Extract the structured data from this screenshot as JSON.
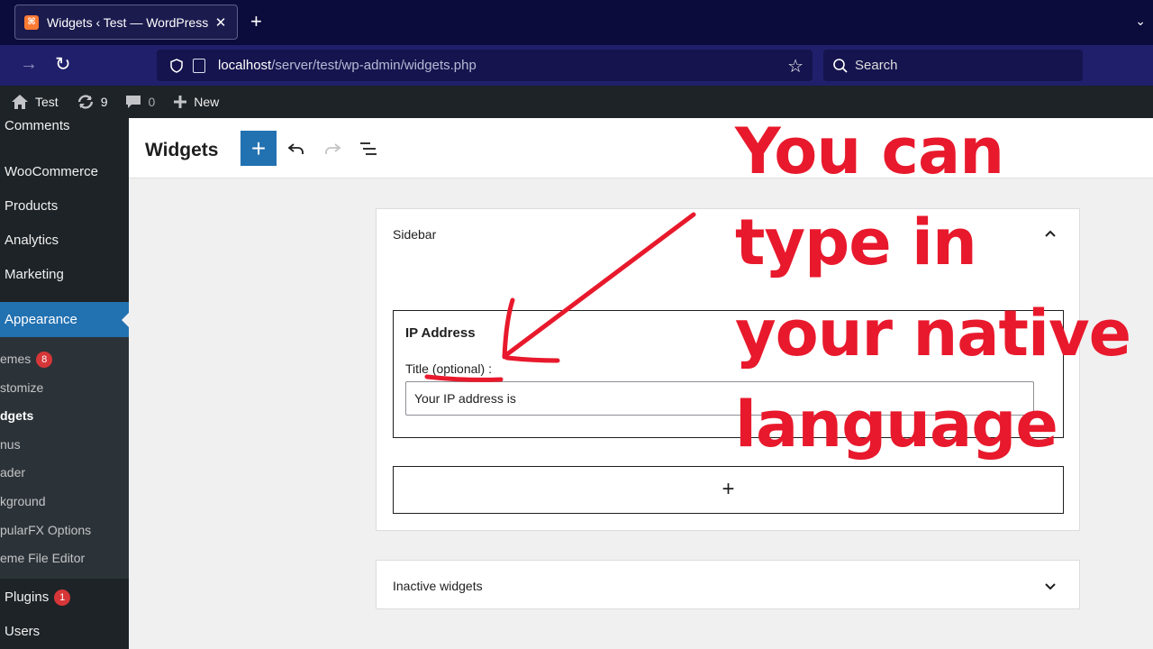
{
  "browser": {
    "tab_title": "Widgets ‹ Test — WordPress",
    "tab_close": "✕",
    "new_tab": "+",
    "url_host": "localhost",
    "url_path": "/server/test/wp-admin/widgets.php",
    "search_placeholder": "Search"
  },
  "adminbar": {
    "site_name": "Test",
    "updates_count": "9",
    "comments_count": "0",
    "new_label": "New"
  },
  "sidebar": {
    "items": {
      "comments": "Comments",
      "woocommerce": "WooCommerce",
      "products": "Products",
      "analytics": "Analytics",
      "marketing": "Marketing",
      "appearance": "Appearance",
      "plugins": "Plugins",
      "plugins_badge": "1",
      "users": "Users"
    },
    "submenu": {
      "themes": "emes",
      "themes_badge": "8",
      "customize": "stomize",
      "widgets": "dgets",
      "menus": "nus",
      "header": "ader",
      "background": "kground",
      "popularfx": "pularFX Options",
      "theme_editor": "eme File Editor"
    }
  },
  "editor": {
    "title": "Widgets",
    "add_block": "+"
  },
  "panel": {
    "title": "Sidebar",
    "widget_name": "IP Address",
    "title_label": "Title (optional) :",
    "title_value": "Your IP address is",
    "appender": "+"
  },
  "inactive_panel": {
    "title": "Inactive widgets"
  },
  "annotation": {
    "line1": "You can",
    "line2": "type in",
    "line3": "your native",
    "line4": "language",
    "color": "#e8192c"
  }
}
